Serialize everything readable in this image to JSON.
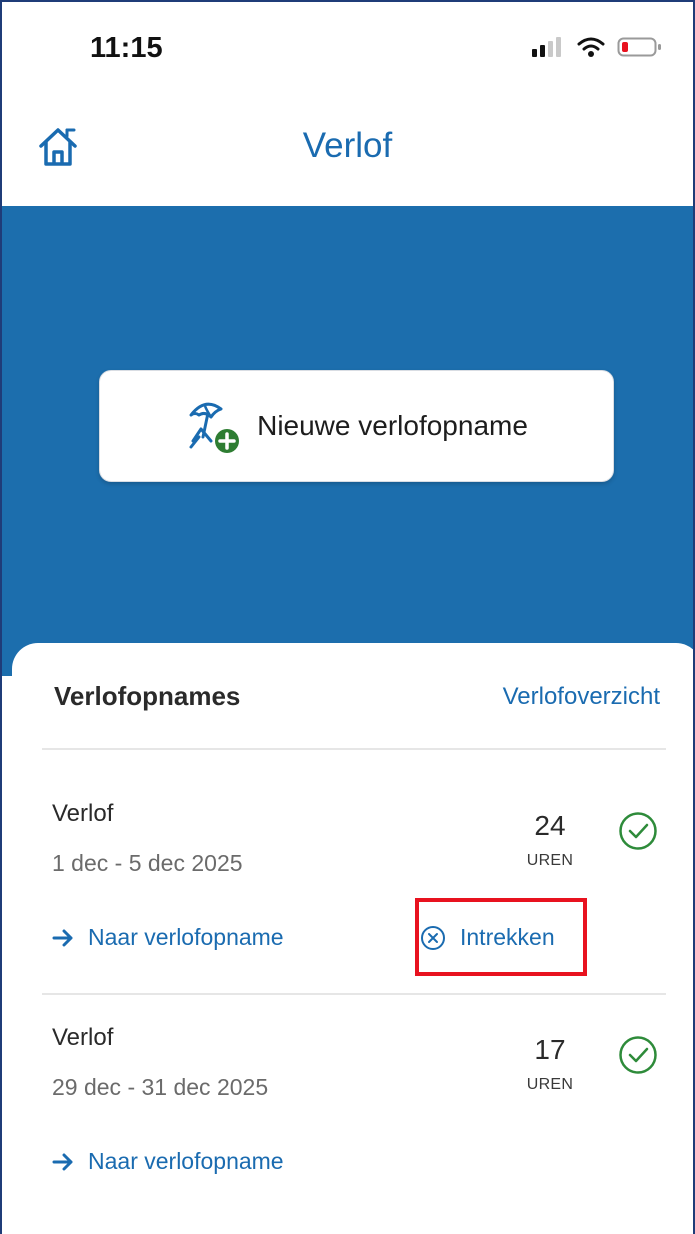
{
  "status_bar": {
    "time": "11:15"
  },
  "header": {
    "title": "Verlof"
  },
  "hero": {
    "new_leave_label": "Nieuwe verlofopname"
  },
  "card": {
    "title": "Verlofopnames",
    "overview_link": "Verlofoverzicht",
    "items": [
      {
        "title": "Verlof",
        "dates": "1 dec - 5 dec 2025",
        "hours": "24",
        "unit": "UREN",
        "link": "Naar verlofopname",
        "withdraw": "Intrekken"
      },
      {
        "title": "Verlof",
        "dates": "29 dec - 31 dec 2025",
        "hours": "17",
        "unit": "UREN",
        "link": "Naar verlofopname"
      }
    ]
  },
  "colors": {
    "brand_blue": "#1c6ead",
    "link_blue": "#1a6bb0",
    "success_green": "#2e8b3a",
    "highlight_red": "#e8121f"
  }
}
